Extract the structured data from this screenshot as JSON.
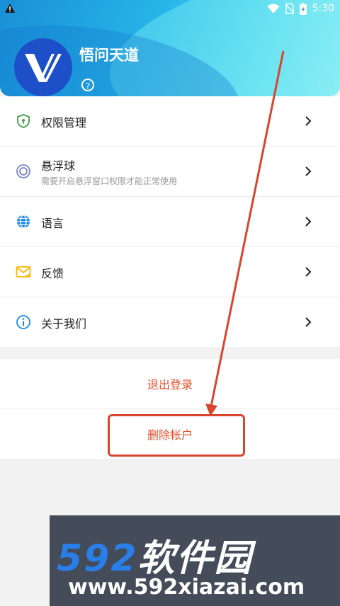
{
  "status_bar": {
    "time": "5:30",
    "left_icon": "warning-icon",
    "right_icons": [
      "wifi-icon",
      "no-sim-icon",
      "battery-icon"
    ]
  },
  "header": {
    "title": "悟问天道",
    "help_glyph": "?",
    "logo_icon": "app-logo-icon"
  },
  "menu": [
    {
      "label": "权限管理",
      "icon": "shield-icon",
      "color": "#43a047"
    },
    {
      "label": "悬浮球",
      "subtitle": "需要开启悬浮窗口权限才能正常使用",
      "icon": "float-ball-icon",
      "color": "#5c6bc0"
    },
    {
      "label": "语言",
      "icon": "globe-icon",
      "color": "#1e88e5"
    },
    {
      "label": "反馈",
      "icon": "mail-icon",
      "color": "#f5b800"
    },
    {
      "label": "关于我们",
      "icon": "info-icon",
      "color": "#1e88e5"
    }
  ],
  "actions": {
    "logout": "退出登录",
    "delete_account": "删除帐户"
  },
  "colors": {
    "action_text": "#e54c2b",
    "annotation": "#d8452f"
  },
  "watermark": {
    "brand_number": "592",
    "brand_text": "软件园",
    "url": "www.592xiazai.com"
  }
}
